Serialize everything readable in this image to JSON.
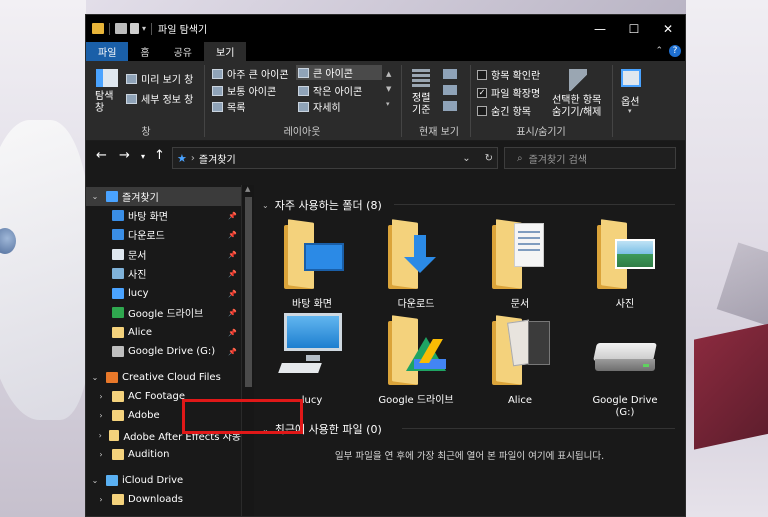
{
  "window": {
    "title": "파일 탐색기",
    "controls": {
      "minimize": "—",
      "maximize": "☐",
      "close": "✕"
    }
  },
  "tabs": [
    {
      "label": "파일"
    },
    {
      "label": "홈"
    },
    {
      "label": "공유"
    },
    {
      "label": "보기"
    }
  ],
  "ribbon": {
    "pane": {
      "nav_label": "탐색\n창",
      "preview": "미리 보기 창",
      "details": "세부 정보 창",
      "group": "창"
    },
    "layout": {
      "items": [
        "아주 큰 아이콘",
        "큰 아이콘",
        "보통 아이콘",
        "작은 아이콘",
        "목록",
        "자세히"
      ],
      "selected": "큰 아이콘",
      "group": "레이아웃"
    },
    "current_view": {
      "sort_label": "정렬\n기준",
      "group": "현재 보기"
    },
    "show_hide": {
      "item_checkboxes": {
        "label": "항목 확인란",
        "checked": false
      },
      "file_extensions": {
        "label": "파일 확장명",
        "checked": true
      },
      "hidden_items": {
        "label": "숨긴 항목",
        "checked": false
      },
      "hide_selected": "선택한 항목\n숨기기/해제",
      "group": "표시/숨기기"
    },
    "options": {
      "label": "옵션"
    }
  },
  "address": {
    "path": "즐겨찾기",
    "search_placeholder": "즐겨찾기 검색"
  },
  "nav": {
    "items": [
      {
        "label": "즐겨찾기",
        "icon": "star-icon",
        "pinned": false
      },
      {
        "label": "바탕 화면",
        "icon": "desktop-icon",
        "pinned": true
      },
      {
        "label": "다운로드",
        "icon": "download-icon",
        "pinned": true
      },
      {
        "label": "문서",
        "icon": "document-icon",
        "pinned": true
      },
      {
        "label": "사진",
        "icon": "pictures-icon",
        "pinned": true
      },
      {
        "label": "lucy",
        "icon": "computer-icon",
        "pinned": true
      },
      {
        "label": "Google 드라이브",
        "icon": "google-drive-icon",
        "pinned": true
      },
      {
        "label": "Alice",
        "icon": "folder-icon",
        "pinned": true
      },
      {
        "label": "Google Drive (G:)",
        "icon": "drive-icon",
        "pinned": true
      },
      {
        "label": "Creative Cloud Files",
        "icon": "creative-cloud-icon",
        "pinned": false
      },
      {
        "label": "AC Footage",
        "icon": "folder-icon",
        "pinned": false
      },
      {
        "label": "Adobe",
        "icon": "folder-icon",
        "pinned": false
      },
      {
        "label": "Adobe After Effects 자동",
        "icon": "folder-icon",
        "pinned": false
      },
      {
        "label": "Audition",
        "icon": "folder-icon",
        "pinned": false
      },
      {
        "label": "iCloud Drive",
        "icon": "icloud-icon",
        "pinned": false
      },
      {
        "label": "Downloads",
        "icon": "folder-icon",
        "pinned": false
      }
    ]
  },
  "frequent": {
    "header": "자주 사용하는 폴더 (8)",
    "items": [
      {
        "label": "바탕 화면",
        "icon": "desktop-folder-icon"
      },
      {
        "label": "다운로드",
        "icon": "downloads-folder-icon"
      },
      {
        "label": "문서",
        "icon": "documents-folder-icon"
      },
      {
        "label": "사진",
        "icon": "pictures-folder-icon"
      },
      {
        "label": "lucy",
        "icon": "computer-icon"
      },
      {
        "label": "Google 드라이브",
        "icon": "google-drive-folder-icon"
      },
      {
        "label": "Alice",
        "icon": "folder-icon"
      },
      {
        "label": "Google Drive\n(G:)",
        "icon": "drive-icon"
      }
    ]
  },
  "recent": {
    "header": "최근에 사용한 파일 (0)",
    "empty_message": "일부 파일을 연 후에 가장 최근에 열어 본 파일이 여기에 표시됩니다."
  },
  "colors": {
    "accent": "#1a5fa8",
    "highlight_box": "#e01818",
    "folder": "#f4d27c"
  }
}
